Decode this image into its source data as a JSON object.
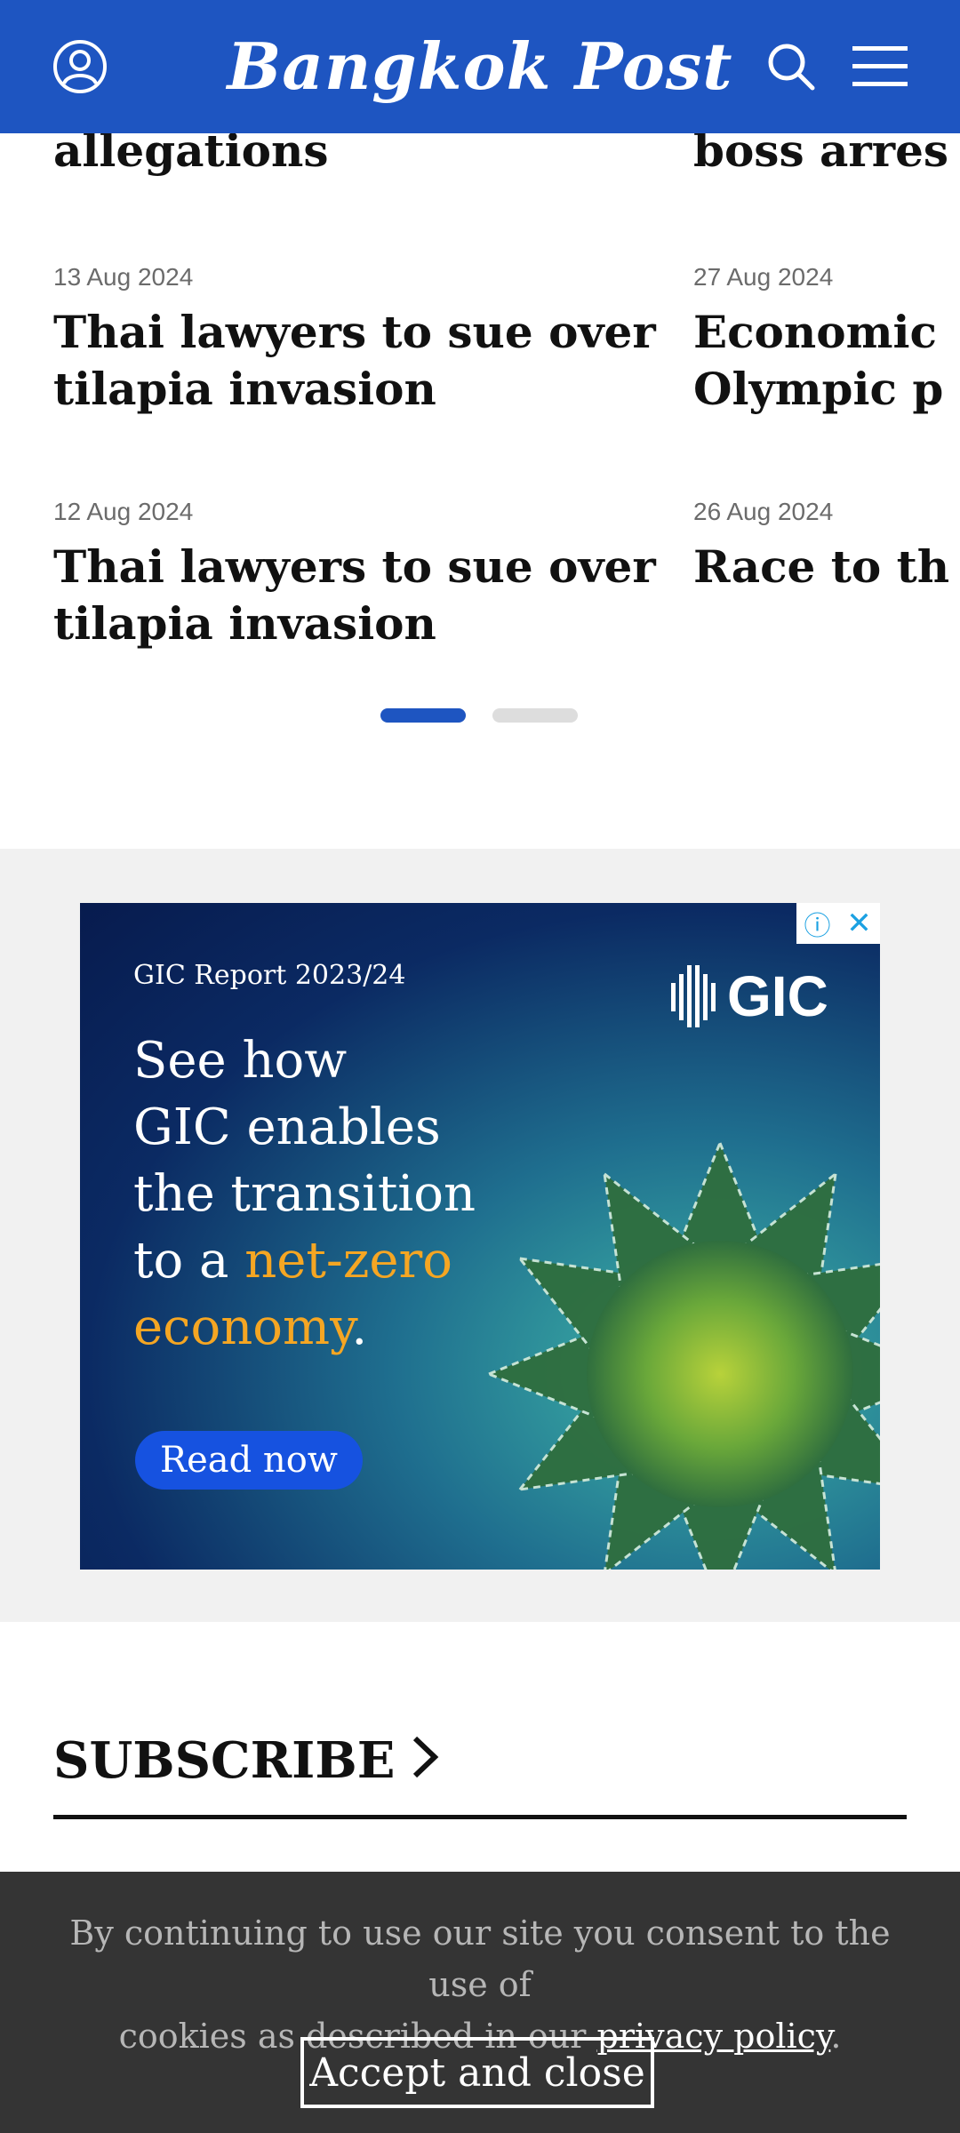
{
  "header": {
    "logo": "Bangkok Post",
    "account_icon": "account-icon",
    "search_icon": "search-icon",
    "menu_icon": "menu-icon",
    "bg_color": "#1e55c1"
  },
  "feed": {
    "left_column": {
      "top_title": "allegations",
      "items": [
        {
          "date": "13 Aug 2024",
          "title_line1": "Thai lawyers to sue over",
          "title_line2": "tilapia invasion"
        },
        {
          "date": "12 Aug 2024",
          "title_line1": "Thai lawyers to sue over",
          "title_line2": "tilapia invasion"
        }
      ]
    },
    "right_column": {
      "top_title": "boss arres",
      "items": [
        {
          "date": "27 Aug 2024",
          "title_line1": "Economic",
          "title_line2": "Olympic p"
        },
        {
          "date": "26 Aug 2024",
          "title_line1": "Race to th",
          "title_line2": ""
        }
      ]
    },
    "pagination": {
      "active_color": "#1e55c1",
      "inactive_color": "#dddddd",
      "current_page": 1,
      "total_pages": 2
    }
  },
  "ad": {
    "report": "GIC Report 2023/24",
    "logo": "GIC",
    "headline_1": "See how",
    "headline_2": "GIC enables",
    "headline_3": "the transition",
    "headline_4_prefix": "to a ",
    "headline_accent_1": "net-zero",
    "headline_accent_2": "economy",
    "headline_suffix": ".",
    "button": "Read now",
    "info_icon": "info-icon",
    "close_icon": "close-icon"
  },
  "subscribe": {
    "label": "SUBSCRIBE",
    "chevron_icon": "chevron-right-icon"
  },
  "cookie": {
    "text_1": "By continuing to use our site you consent to the use of",
    "text_2": "cookies as described in our ",
    "link": "privacy policy",
    "text_end": ".",
    "button": "Accept and close"
  }
}
